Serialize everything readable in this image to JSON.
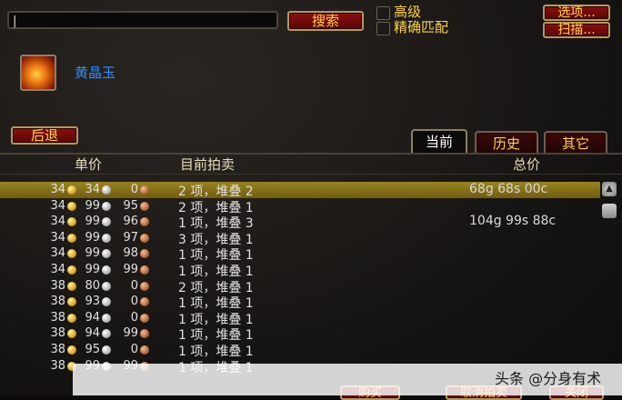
{
  "search": {
    "value": "|",
    "button": "搜索"
  },
  "filters": {
    "advanced": "高级",
    "exact_match": "精确匹配"
  },
  "top_buttons": {
    "options": "选项...",
    "scan": "扫描..."
  },
  "item": {
    "name": "黄晶玉",
    "icon": "topaz-gem-icon"
  },
  "nav": {
    "back": "后退"
  },
  "tabs": [
    {
      "label": "当前",
      "active": true
    },
    {
      "label": "历史",
      "active": false
    },
    {
      "label": "其它",
      "active": false
    }
  ],
  "columns": {
    "unit_price": "单价",
    "current_auction": "目前拍卖",
    "total_price": "总价"
  },
  "rows": [
    {
      "g": "34",
      "s": "34",
      "c": "0",
      "desc": "2 项，堆叠 2",
      "total": "68g 68s 00c",
      "selected": true
    },
    {
      "g": "34",
      "s": "99",
      "c": "95",
      "desc": "2 项，堆叠 1",
      "total": ""
    },
    {
      "g": "34",
      "s": "99",
      "c": "96",
      "desc": "1 项，堆叠 3",
      "total": "104g 99s 88c"
    },
    {
      "g": "34",
      "s": "99",
      "c": "97",
      "desc": "3 项，堆叠 1",
      "total": ""
    },
    {
      "g": "34",
      "s": "99",
      "c": "98",
      "desc": "1 项，堆叠 1",
      "total": ""
    },
    {
      "g": "34",
      "s": "99",
      "c": "99",
      "desc": "1 项，堆叠 1",
      "total": ""
    },
    {
      "g": "38",
      "s": "80",
      "c": "0",
      "desc": "2 项，堆叠 1",
      "total": ""
    },
    {
      "g": "38",
      "s": "93",
      "c": "0",
      "desc": "1 项，堆叠 1",
      "total": ""
    },
    {
      "g": "38",
      "s": "94",
      "c": "0",
      "desc": "1 项，堆叠 1",
      "total": ""
    },
    {
      "g": "38",
      "s": "94",
      "c": "99",
      "desc": "1 项，堆叠 1",
      "total": ""
    },
    {
      "g": "38",
      "s": "95",
      "c": "0",
      "desc": "1 项，堆叠 1",
      "total": ""
    },
    {
      "g": "38",
      "s": "99",
      "c": "99",
      "desc": "1 项，堆叠 1",
      "total": ""
    }
  ],
  "bottom_buttons": {
    "buy": "购买",
    "cancel": "取消拍卖",
    "close": "关闭"
  },
  "watermark": "头条 @分身有术",
  "colors": {
    "accent": "#ffd24a",
    "item_name": "#2a8cff",
    "selection": "#9a8420",
    "button_bg": "#8a1010"
  }
}
